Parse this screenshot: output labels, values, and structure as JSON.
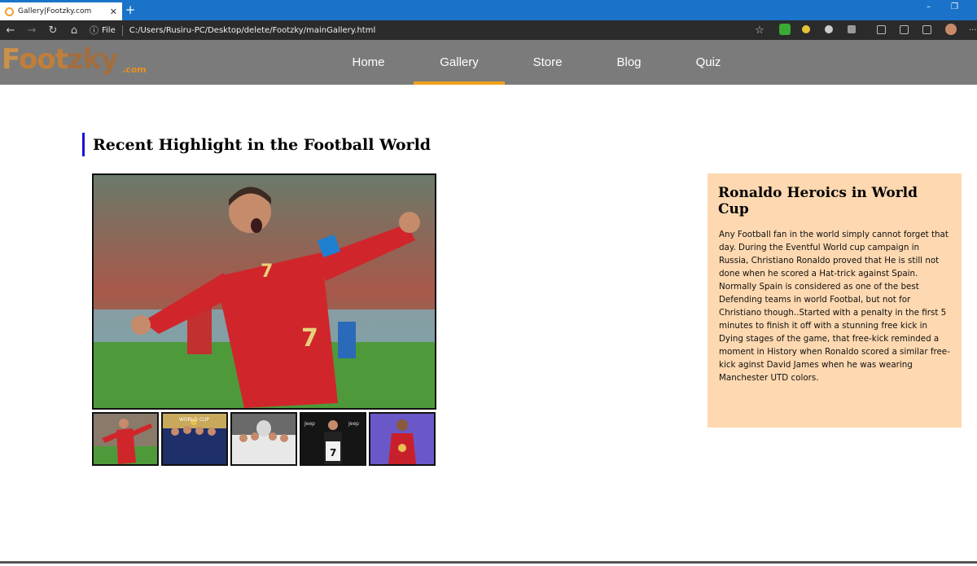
{
  "browser": {
    "tab_title": "Gallery|Footzky.com",
    "close_tab": "✕",
    "new_tab": "+",
    "file_label": "File",
    "url": "C:/Users/Rusiru-PC/Desktop/delete/Footzky/mainGallery.html",
    "minimize": "–",
    "restore": "❐",
    "more": "···"
  },
  "site": {
    "logo_text": "Footzky",
    "logo_suffix": ".com",
    "nav": [
      {
        "label": "Home"
      },
      {
        "label": "Gallery"
      },
      {
        "label": "Store"
      },
      {
        "label": "Blog"
      },
      {
        "label": "Quiz"
      }
    ],
    "active_nav": "Gallery"
  },
  "page": {
    "heading": "Recent Highlight in the Football World",
    "card": {
      "title": "Ronaldo Heroics in World Cup",
      "body": "Any Football fan in the world simply cannot forget that day. During the Eventful World cup campaign in Russia, Christiano Ronaldo proved that He is still not done when he scored a Hat-trick against Spain. Normally Spain is considered as one of the best Defending teams in world Footbal, but not for Christiano though..Started with a penalty in the first 5 minutes to finish it off with a stunning free kick in Dying stages of the game, that free-kick reminded a moment in History when Ronaldo scored a similar free-kick aginst David James when he was wearing Manchester UTD colors."
    }
  },
  "colors": {
    "tabbar": "#1a73c8",
    "nav_bg": "#7b7b7b",
    "nav_active": "#f0a020",
    "heading_bar": "#1a10d8",
    "card_bg": "#fdd8b0"
  }
}
